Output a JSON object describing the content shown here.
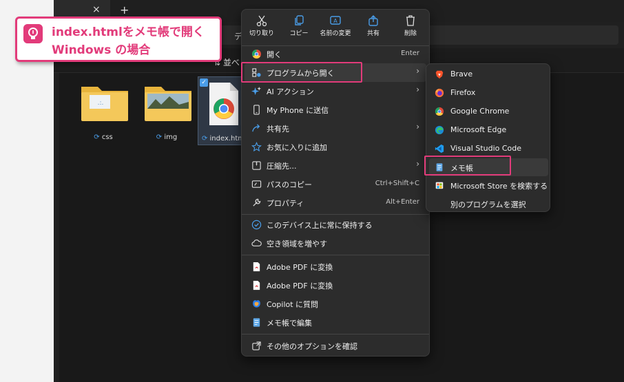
{
  "explorer": {
    "new_tab": "+",
    "tab_close": "×",
    "address_fragment": "デ",
    "sort_label": "並べ",
    "files": [
      {
        "name": "css"
      },
      {
        "name": "img"
      },
      {
        "name": "index.htm"
      }
    ]
  },
  "callout": {
    "line1": "index.htmlをメモ帳で開く",
    "line2": "Windows の場合",
    "accent": "#e23b7a",
    "icon": "lightbulb-icon"
  },
  "context_menu": {
    "toolbar": [
      {
        "label": "切り取り",
        "icon": "scissors-icon"
      },
      {
        "label": "コピー",
        "icon": "copy-icon"
      },
      {
        "label": "名前の変更",
        "icon": "rename-icon"
      },
      {
        "label": "共有",
        "icon": "share-icon"
      },
      {
        "label": "削除",
        "icon": "trash-icon"
      }
    ],
    "items": [
      {
        "label": "開く",
        "shortcut": "Enter",
        "icon": "chrome-icon"
      },
      {
        "label": "プログラムから開く",
        "icon": "open-with-icon",
        "has_submenu": true
      },
      {
        "label": "AI アクション",
        "icon": "ai-sparkle-icon",
        "has_submenu": true
      },
      {
        "label": "My Phone に送信",
        "icon": "phone-icon"
      },
      {
        "label": "共有先",
        "icon": "share-icon",
        "has_submenu": true
      },
      {
        "label": "お気に入りに追加",
        "icon": "star-icon"
      },
      {
        "label": "圧縮先...",
        "icon": "zip-icon",
        "has_submenu": true
      },
      {
        "label": "パスのコピー",
        "shortcut": "Ctrl+Shift+C",
        "icon": "path-icon"
      },
      {
        "label": "プロパティ",
        "shortcut": "Alt+Enter",
        "icon": "wrench-icon"
      },
      {
        "label": "このデバイス上に常に保持する",
        "icon": "cloud-sync-icon"
      },
      {
        "label": "空き領域を増やす",
        "icon": "cloud-icon"
      },
      {
        "label": "Adobe PDF に変換",
        "icon": "adobe-pdf-icon"
      },
      {
        "label": "Adobe PDF に変換",
        "icon": "adobe-pdf-icon"
      },
      {
        "label": "Copilot に質問",
        "icon": "copilot-icon"
      },
      {
        "label": "メモ帳で編集",
        "icon": "notepad-icon"
      },
      {
        "label": "その他のオプションを確認",
        "icon": "more-options-icon"
      }
    ]
  },
  "submenu": {
    "items": [
      {
        "label": "Brave",
        "icon": "brave-icon"
      },
      {
        "label": "Firefox",
        "icon": "firefox-icon"
      },
      {
        "label": "Google Chrome",
        "icon": "chrome-icon"
      },
      {
        "label": "Microsoft Edge",
        "icon": "edge-icon"
      },
      {
        "label": "Visual Studio Code",
        "icon": "vscode-icon"
      },
      {
        "label": "メモ帳",
        "icon": "notepad-icon"
      },
      {
        "label": "Microsoft Store を検索する",
        "icon": "store-icon"
      },
      {
        "label": "別のプログラムを選択",
        "icon": ""
      }
    ]
  }
}
